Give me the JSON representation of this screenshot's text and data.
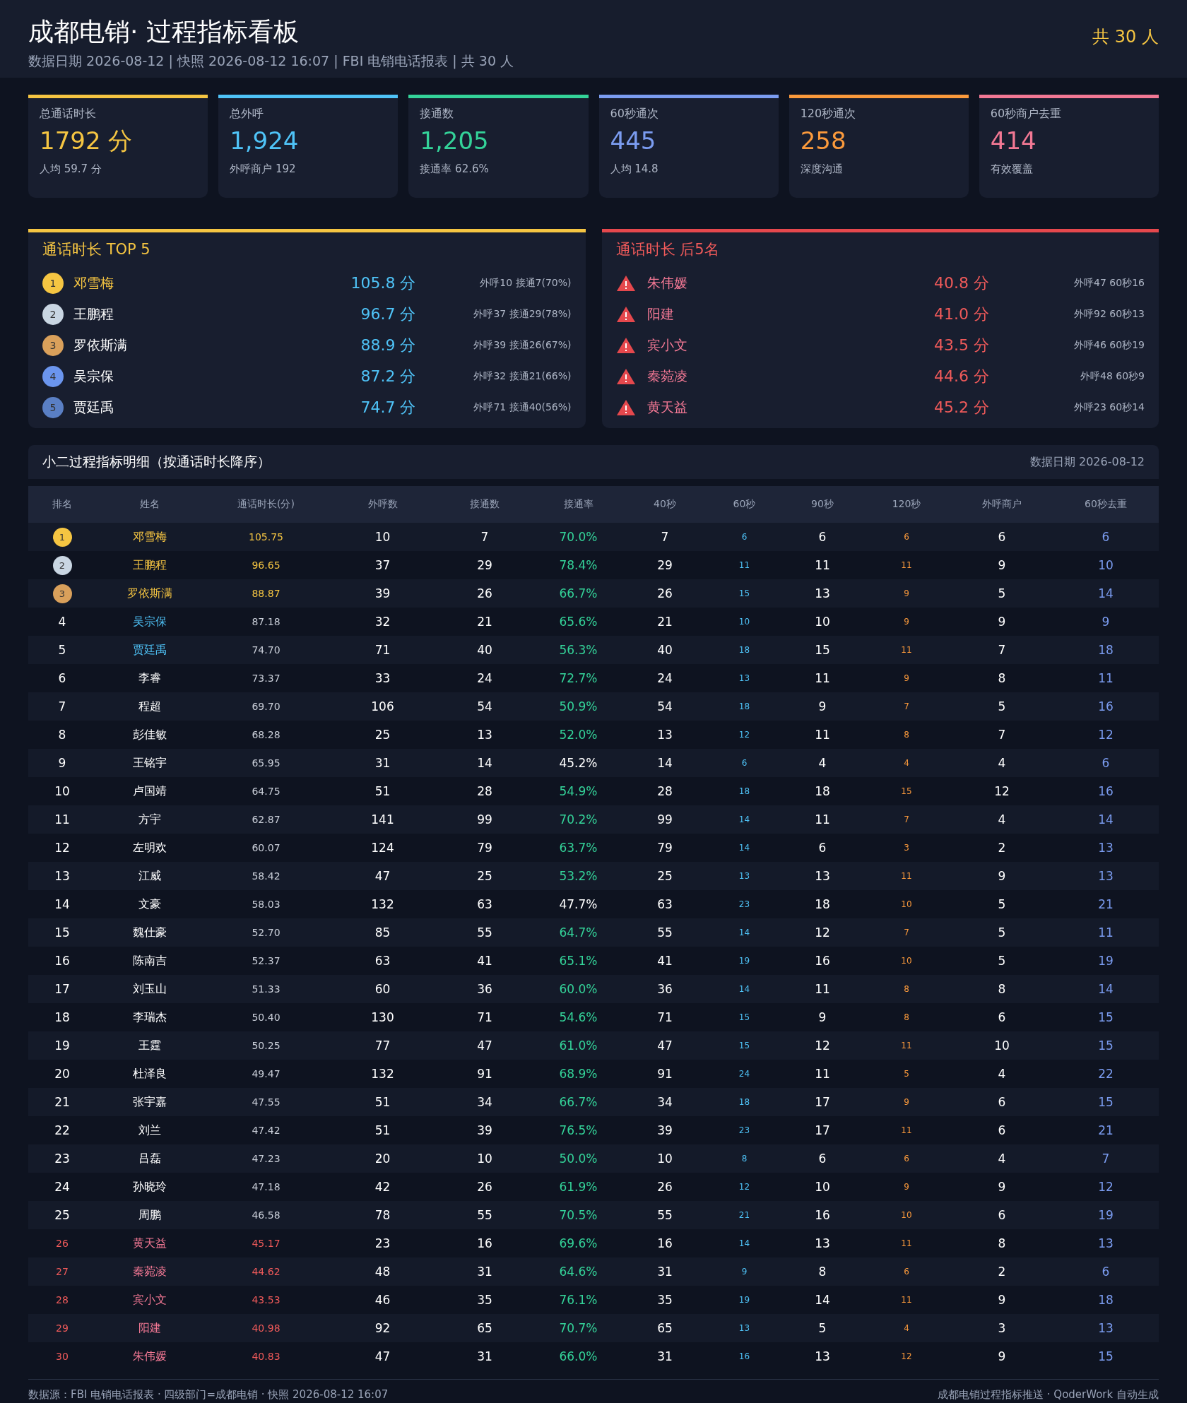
{
  "header": {
    "title": "成都电销· 过程指标看板",
    "subtitle": "数据日期 2026-08-12 | 快照 2026-08-12 16:07 | FBI 电销电话报表 | 共 30 人",
    "headcount": "共 30 人"
  },
  "cards": [
    {
      "label": "总通话时长",
      "value": "1792 分",
      "note": "人均 59.7 分",
      "color": "#f5c542"
    },
    {
      "label": "总外呼",
      "value": "1,924",
      "note": "外呼商户 192",
      "color": "#4fc3f7"
    },
    {
      "label": "接通数",
      "value": "1,205",
      "note": "接通率 62.6%",
      "color": "#34d399"
    },
    {
      "label": "60秒通次",
      "value": "445",
      "note": "人均 14.8",
      "color": "#7b9cf0"
    },
    {
      "label": "120秒通次",
      "value": "258",
      "note": "深度沟通",
      "color": "#fb9a3c"
    },
    {
      "label": "60秒商户去重",
      "value": "414",
      "note": "有效覆盖",
      "color": "#f27894"
    }
  ],
  "top_panel": {
    "title": "通话时长 TOP 5",
    "items": [
      {
        "rank": "1",
        "name": "邓雪梅",
        "value": "105.8 分",
        "detail": "外呼10 接通7(70%)",
        "color": "#f5c542"
      },
      {
        "rank": "2",
        "name": "王鹏程",
        "value": "96.7 分",
        "detail": "外呼37 接通29(78%)",
        "color": "#c9d6e3"
      },
      {
        "rank": "3",
        "name": "罗依斯满",
        "value": "88.9 分",
        "detail": "外呼39 接通26(67%)",
        "color": "#d9a05b"
      },
      {
        "rank": "4",
        "name": "吴宗保",
        "value": "87.2 分",
        "detail": "外呼32 接通21(66%)",
        "color": "#6b95ee"
      },
      {
        "rank": "5",
        "name": "贾廷禹",
        "value": "74.7 分",
        "detail": "外呼71 接通40(56%)",
        "color": "#5a7fc4"
      }
    ]
  },
  "bottom_panel": {
    "title": "通话时长 后5名",
    "items": [
      {
        "name": "朱伟媛",
        "value": "40.8 分",
        "detail": "外呼47 60秒16"
      },
      {
        "name": "阳建",
        "value": "41.0 分",
        "detail": "外呼92 60秒13"
      },
      {
        "name": "宾小文",
        "value": "43.5 分",
        "detail": "外呼46 60秒19"
      },
      {
        "name": "秦菀凌",
        "value": "44.6 分",
        "detail": "外呼48 60秒9"
      },
      {
        "name": "黄天益",
        "value": "45.2 分",
        "detail": "外呼23 60秒14"
      }
    ]
  },
  "table": {
    "title": "小二过程指标明细（按通话时长降序）",
    "date": "数据日期 2026-08-12",
    "columns": [
      "排名",
      "姓名",
      "通话时长(分)",
      "外呼数",
      "接通数",
      "接通率",
      "40秒",
      "60秒",
      "90秒",
      "120秒",
      "外呼商户",
      "60秒去重"
    ],
    "rows": [
      {
        "kind": "medal",
        "color": "#f5c542",
        "rate_pass": true,
        "cells": [
          "1",
          "邓雪梅",
          "105.75",
          "10",
          "7",
          "70.0%",
          "7",
          "6",
          "6",
          "6",
          "6",
          "6"
        ]
      },
      {
        "kind": "medal",
        "color": "#c9d6e3",
        "rate_pass": true,
        "cells": [
          "2",
          "王鹏程",
          "96.65",
          "37",
          "29",
          "78.4%",
          "29",
          "11",
          "11",
          "11",
          "9",
          "10"
        ]
      },
      {
        "kind": "medal",
        "color": "#d9a05b",
        "rate_pass": true,
        "cells": [
          "3",
          "罗依斯满",
          "88.87",
          "39",
          "26",
          "66.7%",
          "26",
          "15",
          "13",
          "9",
          "5",
          "14"
        ]
      },
      {
        "kind": "top",
        "rate_pass": true,
        "cells": [
          "4",
          "吴宗保",
          "87.18",
          "32",
          "21",
          "65.6%",
          "21",
          "10",
          "10",
          "9",
          "9",
          "9"
        ]
      },
      {
        "kind": "top",
        "rate_pass": true,
        "cells": [
          "5",
          "贾廷禹",
          "74.70",
          "71",
          "40",
          "56.3%",
          "40",
          "18",
          "15",
          "11",
          "7",
          "18"
        ]
      },
      {
        "kind": "normal",
        "rate_pass": true,
        "cells": [
          "6",
          "李睿",
          "73.37",
          "33",
          "24",
          "72.7%",
          "24",
          "13",
          "11",
          "9",
          "8",
          "11"
        ]
      },
      {
        "kind": "normal",
        "rate_pass": true,
        "cells": [
          "7",
          "程超",
          "69.70",
          "106",
          "54",
          "50.9%",
          "54",
          "18",
          "9",
          "7",
          "5",
          "16"
        ]
      },
      {
        "kind": "normal",
        "rate_pass": true,
        "cells": [
          "8",
          "彭佳敏",
          "68.28",
          "25",
          "13",
          "52.0%",
          "13",
          "12",
          "11",
          "8",
          "7",
          "12"
        ]
      },
      {
        "kind": "normal",
        "rate_pass": false,
        "cells": [
          "9",
          "王铭宇",
          "65.95",
          "31",
          "14",
          "45.2%",
          "14",
          "6",
          "4",
          "4",
          "4",
          "6"
        ]
      },
      {
        "kind": "normal",
        "rate_pass": true,
        "cells": [
          "10",
          "卢国靖",
          "64.75",
          "51",
          "28",
          "54.9%",
          "28",
          "18",
          "18",
          "15",
          "12",
          "16"
        ]
      },
      {
        "kind": "normal",
        "rate_pass": true,
        "cells": [
          "11",
          "方宇",
          "62.87",
          "141",
          "99",
          "70.2%",
          "99",
          "14",
          "11",
          "7",
          "4",
          "14"
        ]
      },
      {
        "kind": "normal",
        "rate_pass": true,
        "cells": [
          "12",
          "左明欢",
          "60.07",
          "124",
          "79",
          "63.7%",
          "79",
          "14",
          "6",
          "3",
          "2",
          "13"
        ]
      },
      {
        "kind": "normal",
        "rate_pass": true,
        "cells": [
          "13",
          "江威",
          "58.42",
          "47",
          "25",
          "53.2%",
          "25",
          "13",
          "13",
          "11",
          "9",
          "13"
        ]
      },
      {
        "kind": "normal",
        "rate_pass": false,
        "cells": [
          "14",
          "文豪",
          "58.03",
          "132",
          "63",
          "47.7%",
          "63",
          "23",
          "18",
          "10",
          "5",
          "21"
        ]
      },
      {
        "kind": "normal",
        "rate_pass": true,
        "cells": [
          "15",
          "魏仕豪",
          "52.70",
          "85",
          "55",
          "64.7%",
          "55",
          "14",
          "12",
          "7",
          "5",
          "11"
        ]
      },
      {
        "kind": "normal",
        "rate_pass": true,
        "cells": [
          "16",
          "陈南吉",
          "52.37",
          "63",
          "41",
          "65.1%",
          "41",
          "19",
          "16",
          "10",
          "5",
          "19"
        ]
      },
      {
        "kind": "normal",
        "rate_pass": true,
        "cells": [
          "17",
          "刘玉山",
          "51.33",
          "60",
          "36",
          "60.0%",
          "36",
          "14",
          "11",
          "8",
          "8",
          "14"
        ]
      },
      {
        "kind": "normal",
        "rate_pass": true,
        "cells": [
          "18",
          "李瑞杰",
          "50.40",
          "130",
          "71",
          "54.6%",
          "71",
          "15",
          "9",
          "8",
          "6",
          "15"
        ]
      },
      {
        "kind": "normal",
        "rate_pass": true,
        "cells": [
          "19",
          "王霆",
          "50.25",
          "77",
          "47",
          "61.0%",
          "47",
          "15",
          "12",
          "11",
          "10",
          "15"
        ]
      },
      {
        "kind": "normal",
        "rate_pass": true,
        "cells": [
          "20",
          "杜泽良",
          "49.47",
          "132",
          "91",
          "68.9%",
          "91",
          "24",
          "11",
          "5",
          "4",
          "22"
        ]
      },
      {
        "kind": "normal",
        "rate_pass": true,
        "cells": [
          "21",
          "张宇嘉",
          "47.55",
          "51",
          "34",
          "66.7%",
          "34",
          "18",
          "17",
          "9",
          "6",
          "15"
        ]
      },
      {
        "kind": "normal",
        "rate_pass": true,
        "cells": [
          "22",
          "刘兰",
          "47.42",
          "51",
          "39",
          "76.5%",
          "39",
          "23",
          "17",
          "11",
          "6",
          "21"
        ]
      },
      {
        "kind": "normal",
        "rate_pass": true,
        "cells": [
          "23",
          "吕磊",
          "47.23",
          "20",
          "10",
          "50.0%",
          "10",
          "8",
          "6",
          "6",
          "4",
          "7"
        ]
      },
      {
        "kind": "normal",
        "rate_pass": true,
        "cells": [
          "24",
          "孙晓玲",
          "47.18",
          "42",
          "26",
          "61.9%",
          "26",
          "12",
          "10",
          "9",
          "9",
          "12"
        ]
      },
      {
        "kind": "normal",
        "rate_pass": true,
        "cells": [
          "25",
          "周鹏",
          "46.58",
          "78",
          "55",
          "70.5%",
          "55",
          "21",
          "16",
          "10",
          "6",
          "19"
        ]
      },
      {
        "kind": "bottom",
        "rate_pass": true,
        "cells": [
          "26",
          "黄天益",
          "45.17",
          "23",
          "16",
          "69.6%",
          "16",
          "14",
          "13",
          "11",
          "8",
          "13"
        ]
      },
      {
        "kind": "bottom",
        "rate_pass": true,
        "cells": [
          "27",
          "秦菀凌",
          "44.62",
          "48",
          "31",
          "64.6%",
          "31",
          "9",
          "8",
          "6",
          "2",
          "6"
        ]
      },
      {
        "kind": "bottom",
        "rate_pass": true,
        "cells": [
          "28",
          "宾小文",
          "43.53",
          "46",
          "35",
          "76.1%",
          "35",
          "19",
          "14",
          "11",
          "9",
          "18"
        ]
      },
      {
        "kind": "bottom",
        "rate_pass": true,
        "cells": [
          "29",
          "阳建",
          "40.98",
          "92",
          "65",
          "70.7%",
          "65",
          "13",
          "5",
          "4",
          "3",
          "13"
        ]
      },
      {
        "kind": "bottom",
        "rate_pass": true,
        "cells": [
          "30",
          "朱伟媛",
          "40.83",
          "47",
          "31",
          "66.0%",
          "31",
          "16",
          "13",
          "12",
          "9",
          "15"
        ]
      }
    ]
  },
  "footer": {
    "left": "数据源：FBI 电销电话报表 · 四级部门=成都电销 · 快照 2026-08-12 16:07",
    "right": "成都电销过程指标推送 · QoderWork 自动生成"
  }
}
